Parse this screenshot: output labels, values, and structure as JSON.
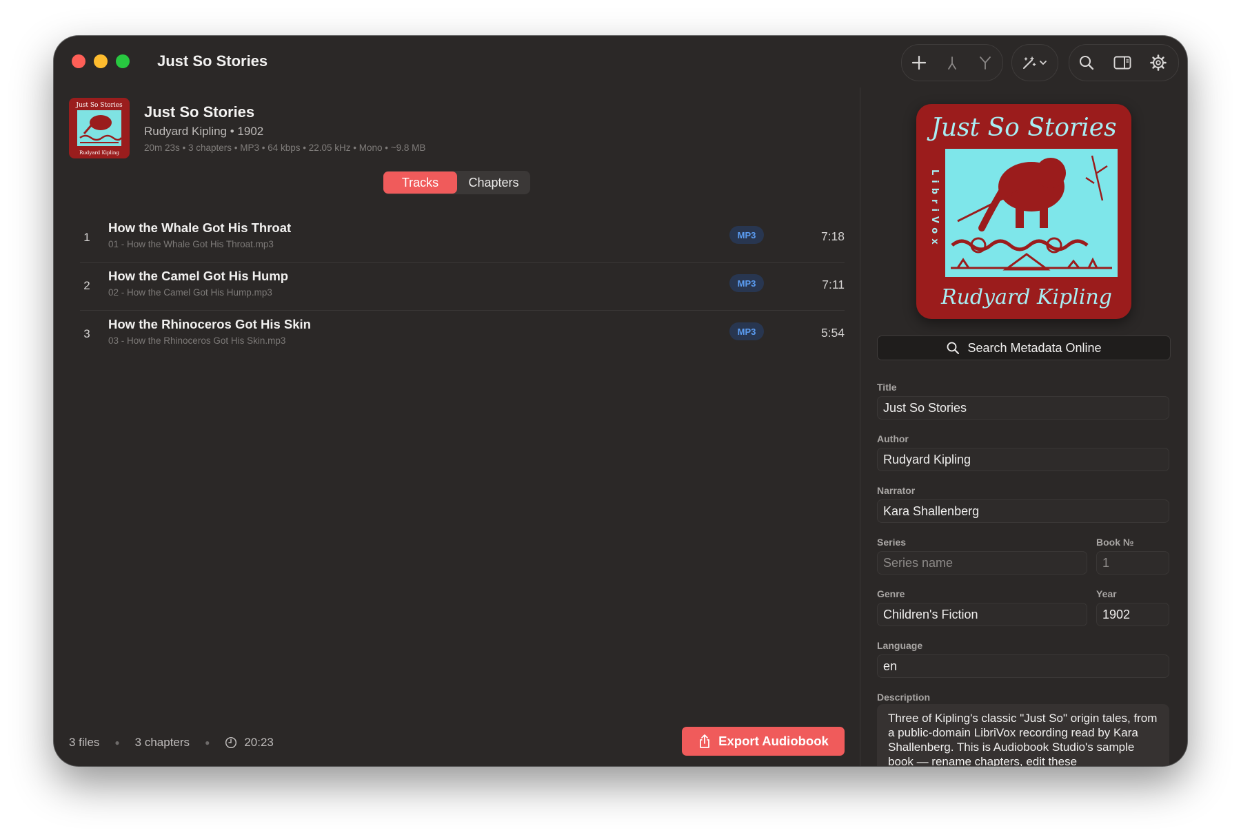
{
  "window": {
    "title": "Just So Stories"
  },
  "toolbar": {
    "icons": [
      "plus-icon",
      "merge-icon",
      "split-icon",
      "magic-wand-icon",
      "search-icon",
      "inspector-icon",
      "gear-icon"
    ]
  },
  "book": {
    "title": "Just So Stories",
    "subtitle": "Rudyard Kipling • 1902",
    "meta": "20m 23s • 3 chapters • MP3 • 64 kbps • 22.05 kHz • Mono • ~9.8 MB"
  },
  "segmented": {
    "tracks": "Tracks",
    "chapters": "Chapters",
    "selected": "Tracks"
  },
  "tracks": [
    {
      "num": "1",
      "name": "How the Whale Got His Throat",
      "file": "01 - How the Whale Got His Throat.mp3",
      "format": "MP3",
      "duration": "7:18"
    },
    {
      "num": "2",
      "name": "How the Camel Got His Hump",
      "file": "02 - How the Camel Got His Hump.mp3",
      "format": "MP3",
      "duration": "7:11"
    },
    {
      "num": "3",
      "name": "How the Rhinoceros Got His Skin",
      "file": "03 - How the Rhinoceros Got His Skin.mp3",
      "format": "MP3",
      "duration": "5:54"
    }
  ],
  "footer": {
    "files": "3 files",
    "chapters": "3 chapters",
    "duration": "20:23",
    "export_label": "Export Audiobook"
  },
  "cover": {
    "title": "Just So Stories",
    "author": "Rudyard Kipling",
    "publisher": "LibriVox"
  },
  "search_metadata_label": "Search Metadata Online",
  "fields": {
    "title": {
      "label": "Title",
      "value": "Just So Stories"
    },
    "author": {
      "label": "Author",
      "value": "Rudyard Kipling"
    },
    "narrator": {
      "label": "Narrator",
      "value": "Kara Shallenberg"
    },
    "series": {
      "label": "Series",
      "placeholder": "Series name"
    },
    "book_no": {
      "label": "Book №",
      "placeholder": "1"
    },
    "genre": {
      "label": "Genre",
      "value": "Children's Fiction"
    },
    "year": {
      "label": "Year",
      "value": "1902"
    },
    "language": {
      "label": "Language",
      "value": "en"
    },
    "description": {
      "label": "Description",
      "value": "Three of Kipling's classic \"Just So\" origin tales, from a public-domain LibriVox recording read by Kara Shallenberg. This is Audiobook Studio's sample book — rename chapters, edit these"
    }
  },
  "colors": {
    "accent": "#f05b5b",
    "background": "#2b2827",
    "badge_text": "#5b9cf1"
  }
}
